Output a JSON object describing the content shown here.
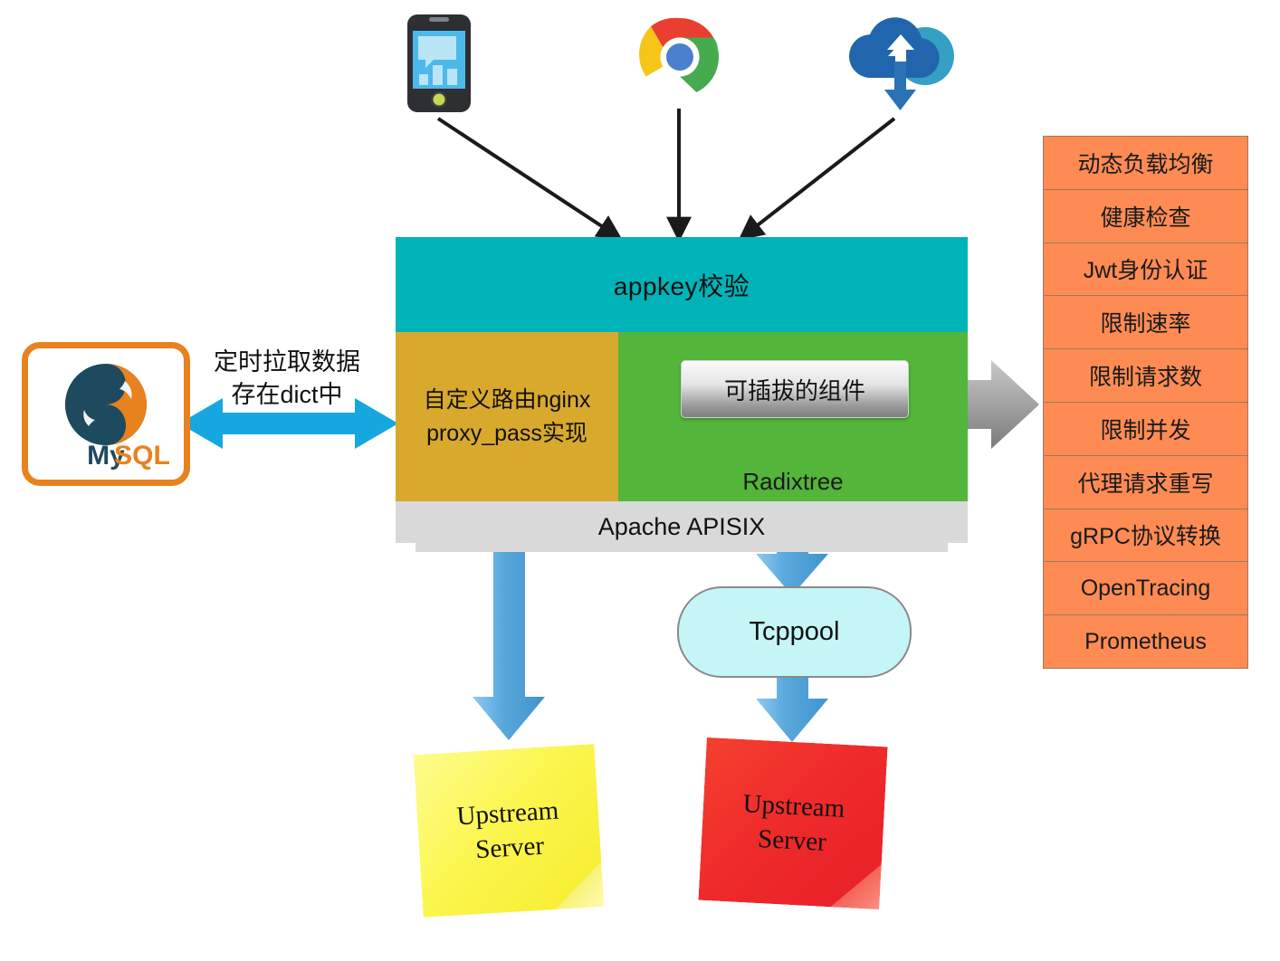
{
  "diagram": {
    "title": "Apache APISIX architecture",
    "clients": [
      {
        "name": "mobile-app",
        "icon": "smartphone-chart-icon"
      },
      {
        "name": "browser",
        "icon": "chrome-browser-icon"
      },
      {
        "name": "cloud-sync",
        "icon": "cloud-sync-icon"
      }
    ],
    "gateway": {
      "appkey_band": "appkey校验",
      "route_panel": "自定义路由nginx\nproxy_pass实现",
      "route_panel_line1": "自定义路由nginx",
      "route_panel_line2": "proxy_pass实现",
      "radixtree_label": "Radixtree",
      "plugin_banner": "可插拔的组件",
      "footer": "Apache APISIX"
    },
    "datastore": {
      "name": "MySQL",
      "logo": "mysql-dolphin-logo",
      "caption_line1": "定时拉取数据",
      "caption_line2": "存在dict中"
    },
    "tcppool": {
      "label": "Tcppool"
    },
    "upstreams": [
      {
        "id": "upstream-yellow",
        "line1": "Upstream",
        "line2": "Server",
        "color": "#f7ef3b"
      },
      {
        "id": "upstream-red",
        "line1": "Upstream",
        "line2": "Server",
        "color": "#ee2b2b"
      }
    ],
    "features": [
      "动态负载均衡",
      "健康检查",
      "Jwt身份认证",
      "限制速率",
      "限制请求数",
      "限制并发",
      "代理请求重写",
      "gRPC协议转换",
      "OpenTracing",
      "Prometheus"
    ],
    "colors": {
      "appkey_teal": "#00b3b8",
      "route_gold": "#d9a92e",
      "radix_green": "#53b53a",
      "footer_gray": "#d9d9d9",
      "feature_orange": "#fd8b53",
      "feature_border": "#9a7a5c",
      "arrow_blue": "#5aa9dd",
      "db_arrow_blue": "#17a7e0",
      "tcppool_fill": "#c5f5f7",
      "mysql_border": "#e8821e",
      "arrow_black": "#1a1a1a"
    }
  }
}
